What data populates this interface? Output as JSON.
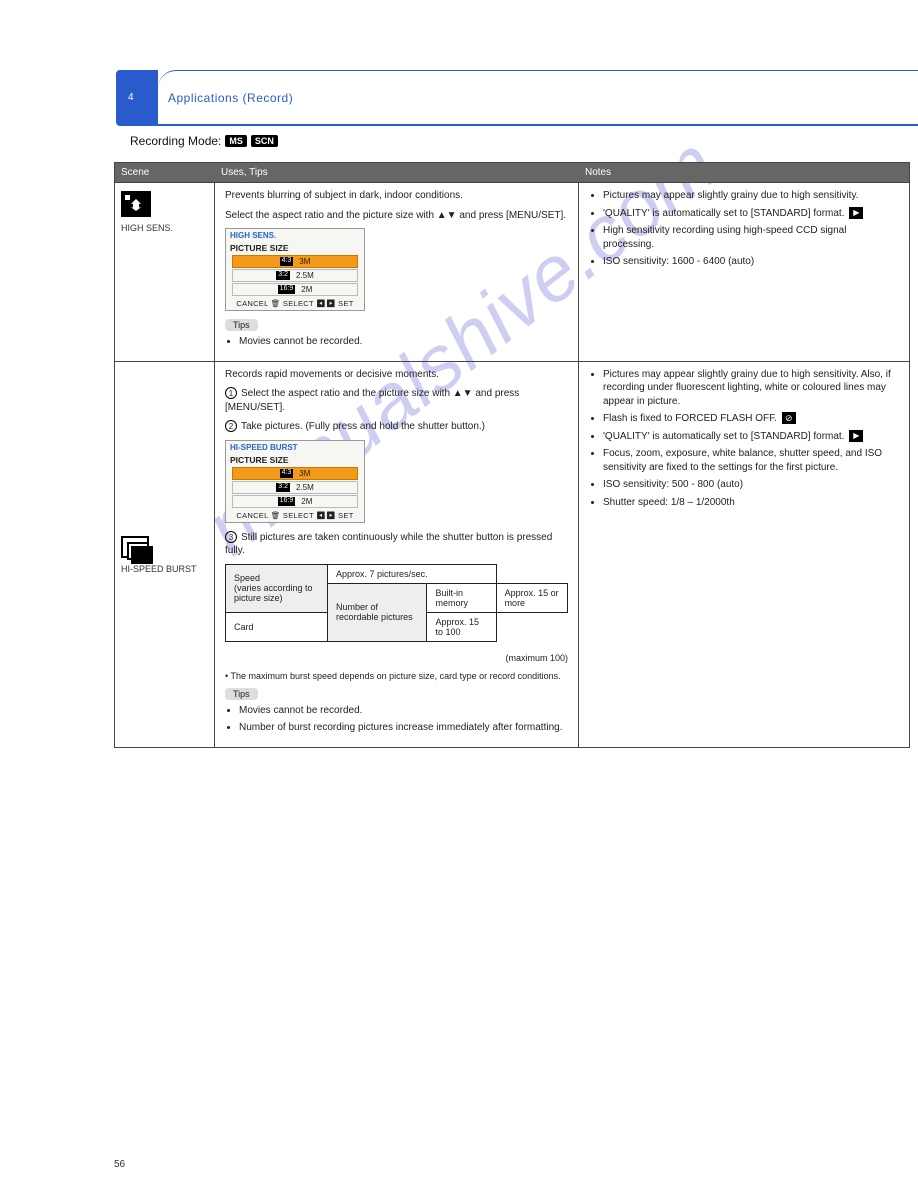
{
  "header": {
    "tab_number": "4",
    "title": "Applications (Record)",
    "sub_prefix": "Recording Mode:",
    "badges": [
      "MS",
      "SCN"
    ]
  },
  "columns": {
    "c1": "Scene",
    "c2": "Uses, Tips",
    "c3": "Notes"
  },
  "watermark": "manualshive.com",
  "page_number": "56",
  "row1": {
    "label": "HIGH SENS.",
    "p1": "Prevents blurring of subject in dark, indoor conditions.",
    "p2": "Select the aspect ratio and the picture size with ▲▼ and press [MENU/SET].",
    "lcd": {
      "mode": "HIGH SENS.",
      "title": "PICTURE SIZE",
      "rows": [
        {
          "ar": "4:3",
          "val": "3M",
          "sel": true
        },
        {
          "ar": "3:2",
          "val": "2.5M",
          "sel": false
        },
        {
          "ar": "16:9",
          "val": "2M",
          "sel": false
        }
      ],
      "footer": "CANCEL 🗑 SELECT ◀▶ SET"
    },
    "tips_label": "Tips",
    "tips": [
      "Movies cannot be recorded."
    ],
    "notes": [
      "Pictures may appear slightly grainy due to high sensitivity.",
      "'QUALITY' is automatically set to [STANDARD] format.",
      "High sensitivity recording using high-speed CCD signal processing.",
      "ISO sensitivity: 1600 - 6400 (auto)"
    ]
  },
  "row2": {
    "label": "HI-SPEED BURST",
    "p1": "Records rapid movements or decisive moments.",
    "s1": "Select the aspect ratio and the picture size with ▲▼ and press [MENU/SET].",
    "s2": "Take pictures. (Fully press and hold the shutter button.)",
    "lcd": {
      "mode": "HI-SPEED BURST",
      "title": "PICTURE SIZE",
      "rows": [
        {
          "ar": "4:3",
          "val": "3M",
          "sel": true
        },
        {
          "ar": "3:2",
          "val": "2.5M",
          "sel": false
        },
        {
          "ar": "16:9",
          "val": "2M",
          "sel": false
        }
      ],
      "footer": "CANCEL 🗑 SELECT ◀▶ SET"
    },
    "s3": "Still pictures are taken continuously while the shutter button is pressed fully.",
    "table": {
      "h1": "Speed",
      "h1v": "Approx. 7 pictures/sec.",
      "h2": "(varies according to picture size)",
      "h3": "Number of recordable pictures",
      "r1k": "Built-in memory",
      "r1v": "Approx. 15 or more",
      "r2k": "Card",
      "r2v": "Approx. 15 to 100",
      "foot": "(maximum 100)"
    },
    "note_below": "• The maximum burst speed depends on picture size, card type or record conditions.",
    "tips_label": "Tips",
    "tips": [
      "Movies cannot be recorded.",
      "Number of burst recording pictures increase immediately after formatting."
    ],
    "notes": [
      "Pictures may appear slightly grainy due to high sensitivity. Also, if recording under fluorescent lighting, white or coloured lines may appear in picture.",
      "Flash is fixed to FORCED FLASH OFF.",
      "'QUALITY' is automatically set to [STANDARD] format.",
      "Focus, zoom, exposure, white balance, shutter speed, and ISO sensitivity are fixed to the settings for the first picture.",
      "ISO sensitivity: 500 - 800 (auto)",
      "Shutter speed: 1/8 – 1/2000th"
    ]
  }
}
